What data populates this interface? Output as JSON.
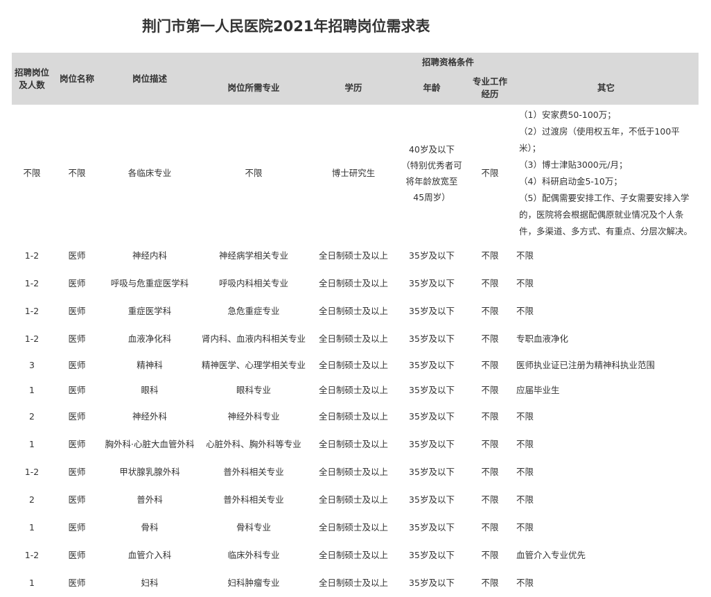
{
  "title": "荆门市第一人民医院2021年招聘岗位需求表",
  "headers": {
    "count": "招聘岗位及人数",
    "name": "岗位名称",
    "desc": "岗位描述",
    "conditions": "招聘资格条件",
    "major": "岗位所需专业",
    "degree": "学历",
    "age": "年龄",
    "experience": "专业工作经历",
    "other": "其它"
  },
  "first_row": {
    "count": "不限",
    "name": "不限",
    "desc": "各临床专业",
    "major": "不限",
    "degree": "博士研究生",
    "age": "40岁及以下（特别优秀者可将年龄放宽至45周岁）",
    "experience": "不限",
    "perks": [
      "（1）安家费50-100万；",
      "（2）过渡房（使用权五年，不低于100平米）；",
      "（3）博士津贴3000元/月；",
      "（4）科研启动金5-10万；",
      "（5）配偶需要安排工作、子女需要安排入学的，医院将会根据配偶原就业情况及个人条件，多渠道、多方式、有重点、分层次解决。"
    ]
  },
  "rows": [
    {
      "count": "1-2",
      "name": "医师",
      "desc": "神经内科",
      "major": "神经病学相关专业",
      "degree": "全日制硕士及以上",
      "age": "35岁及以下",
      "experience": "不限",
      "other": "不限"
    },
    {
      "count": "1-2",
      "name": "医师",
      "desc": "呼吸与危重症医学科",
      "major": "呼吸内科相关专业",
      "degree": "全日制硕士及以上",
      "age": "35岁及以下",
      "experience": "不限",
      "other": "不限"
    },
    {
      "count": "1-2",
      "name": "医师",
      "desc": "重症医学科",
      "major": "急危重症专业",
      "degree": "全日制硕士及以上",
      "age": "35岁及以下",
      "experience": "不限",
      "other": "不限"
    },
    {
      "count": "1-2",
      "name": "医师",
      "desc": "血液净化科",
      "major": "肾内科、血液内科相关专业",
      "degree": "全日制硕士及以上",
      "age": "35岁及以下",
      "experience": "不限",
      "other": "专职血液净化"
    },
    {
      "count": "3",
      "name": "医师",
      "desc": "精神科",
      "major": "精神医学、心理学相关专业",
      "degree": "全日制硕士及以上",
      "age": "35岁及以下",
      "experience": "不限",
      "other": "医师执业证已注册为精神科执业范围"
    },
    {
      "count": "1",
      "name": "医师",
      "desc": "眼科",
      "major": "眼科专业",
      "degree": "全日制硕士及以上",
      "age": "35岁及以下",
      "experience": "不限",
      "other": "应届毕业生"
    },
    {
      "count": "2",
      "name": "医师",
      "desc": "神经外科",
      "major": "神经外科专业",
      "degree": "全日制硕士及以上",
      "age": "35岁及以下",
      "experience": "不限",
      "other": "不限"
    },
    {
      "count": "1",
      "name": "医师",
      "desc": "胸外科·心脏大血管外科",
      "major": "心脏外科、胸外科等专业",
      "degree": "全日制硕士及以上",
      "age": "35岁及以下",
      "experience": "不限",
      "other": "不限"
    },
    {
      "count": "1-2",
      "name": "医师",
      "desc": "甲状腺乳腺外科",
      "major": "普外科相关专业",
      "degree": "全日制硕士及以上",
      "age": "35岁及以下",
      "experience": "不限",
      "other": "不限"
    },
    {
      "count": "2",
      "name": "医师",
      "desc": "普外科",
      "major": "普外科相关专业",
      "degree": "全日制硕士及以上",
      "age": "35岁及以下",
      "experience": "不限",
      "other": "不限"
    },
    {
      "count": "1",
      "name": "医师",
      "desc": "骨科",
      "major": "骨科专业",
      "degree": "全日制硕士及以上",
      "age": "35岁及以下",
      "experience": "不限",
      "other": "不限"
    },
    {
      "count": "1-2",
      "name": "医师",
      "desc": "血管介入科",
      "major": "临床外科专业",
      "degree": "全日制硕士及以上",
      "age": "35岁及以下",
      "experience": "不限",
      "other": "血管介入专业优先"
    },
    {
      "count": "1",
      "name": "医师",
      "desc": "妇科",
      "major": "妇科肿瘤专业",
      "degree": "全日制硕士及以上",
      "age": "35岁及以下",
      "experience": "不限",
      "other": "不限"
    }
  ]
}
